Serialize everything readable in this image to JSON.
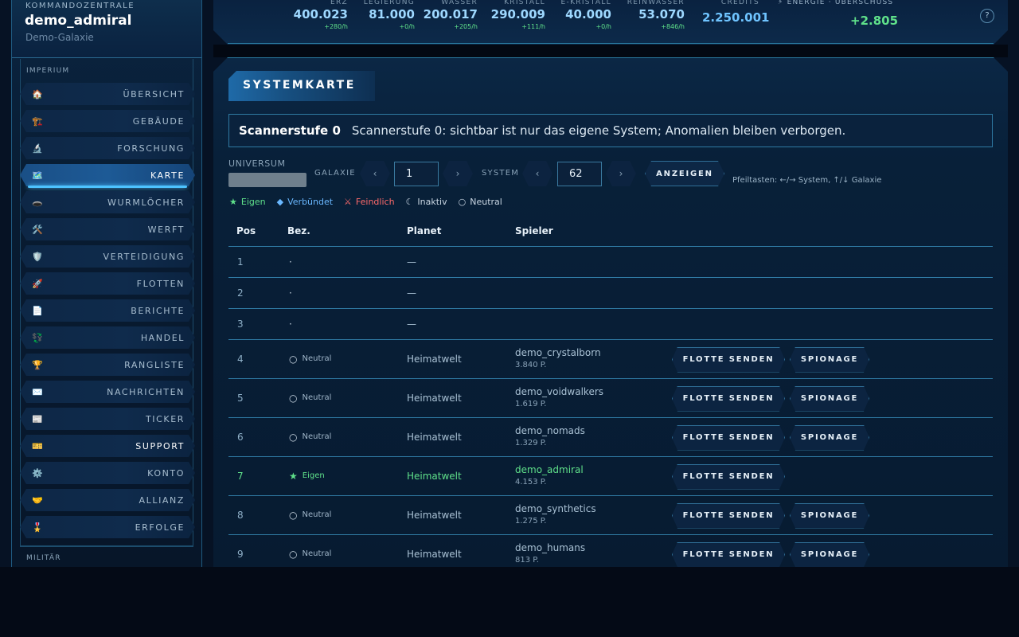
{
  "sidebar": {
    "kicker": "KOMMANDOZENTRALE",
    "username": "demo_admiral",
    "galaxy": "Demo-Galaxie",
    "section_empire": "IMPERIUM",
    "section_military": "MILITÄR",
    "items": [
      {
        "icon": "🏠",
        "label": "ÜBERSICHT"
      },
      {
        "icon": "🏗️",
        "label": "GEBÄUDE"
      },
      {
        "icon": "🔬",
        "label": "FORSCHUNG"
      },
      {
        "icon": "🗺️",
        "label": "KARTE"
      },
      {
        "icon": "🕳️",
        "label": "WURMLÖCHER"
      },
      {
        "icon": "🛠️",
        "label": "WERFT"
      },
      {
        "icon": "🛡️",
        "label": "VERTEIDIGUNG"
      },
      {
        "icon": "🚀",
        "label": "FLOTTEN"
      },
      {
        "icon": "📄",
        "label": "BERICHTE"
      },
      {
        "icon": "💱",
        "label": "HANDEL"
      },
      {
        "icon": "🏆",
        "label": "RANGLISTE"
      },
      {
        "icon": "✉️",
        "label": "NACHRICHTEN"
      },
      {
        "icon": "📰",
        "label": "TICKER"
      },
      {
        "icon": "🎫",
        "label": "SUPPORT"
      },
      {
        "icon": "⚙️",
        "label": "KONTO"
      },
      {
        "icon": "🤝",
        "label": "ALLIANZ"
      },
      {
        "icon": "🎖️",
        "label": "ERFOLGE"
      }
    ]
  },
  "resources": [
    {
      "label": "ERZ",
      "value": "400.023",
      "rate": "+280/h"
    },
    {
      "label": "LEGIERUNG",
      "value": "81.000",
      "rate": "+0/h"
    },
    {
      "label": "WASSER",
      "value": "200.017",
      "rate": "+205/h"
    },
    {
      "label": "KRISTALL",
      "value": "290.009",
      "rate": "+111/h"
    },
    {
      "label": "E-KRISTALL",
      "value": "40.000",
      "rate": "+0/h"
    },
    {
      "label": "REINWASSER",
      "value": "53.070",
      "rate": "+846/h"
    }
  ],
  "credits": {
    "label": "CREDITS",
    "value": "2.250.001"
  },
  "energy": {
    "label": "⚡ ENERGIE · ÜBERSCHUSS",
    "value": "+2.805"
  },
  "help_label": "?",
  "page": {
    "title": "SYSTEMKARTE",
    "scanner_level": "Scannerstufe 0",
    "scanner_text": "Scannerstufe 0: sichtbar ist nur das eigene System; Anomalien bleiben verborgen."
  },
  "controls": {
    "universe_label": "UNIVERSUM",
    "galaxy_label": "GALAXIE",
    "galaxy_value": "1",
    "system_label": "SYSTEM",
    "system_value": "62",
    "prev": "‹",
    "next": "›",
    "show_button": "ANZEIGEN",
    "hint": "Pfeiltasten: ←/→ System, ↑/↓ Galaxie"
  },
  "legend": [
    {
      "icon": "★",
      "label": "Eigen",
      "color": "#5fe08a"
    },
    {
      "icon": "◆",
      "label": "Verbündet",
      "color": "#6ab8ff"
    },
    {
      "icon": "⚔",
      "label": "Feindlich",
      "color": "#ff6a6a"
    },
    {
      "icon": "☾",
      "label": "Inaktiv",
      "color": "#c9d6e2"
    },
    {
      "icon": "○",
      "label": "Neutral",
      "color": "#c9d6e2"
    }
  ],
  "table": {
    "headers": [
      "Pos",
      "Bez.",
      "Planet",
      "Spieler"
    ],
    "rows": [
      {
        "pos": "1",
        "bez_icon": "·",
        "bez": "",
        "planet": "—",
        "player": "",
        "points": "",
        "actions": []
      },
      {
        "pos": "2",
        "bez_icon": "·",
        "bez": "",
        "planet": "—",
        "player": "",
        "points": "",
        "actions": []
      },
      {
        "pos": "3",
        "bez_icon": "·",
        "bez": "",
        "planet": "—",
        "player": "",
        "points": "",
        "actions": []
      },
      {
        "pos": "4",
        "bez_icon": "○",
        "bez": "Neutral",
        "planet": "Heimatwelt",
        "player": "demo_crystalborn",
        "points": "3.840 P.",
        "actions": [
          "FLOTTE SENDEN",
          "SPIONAGE"
        ]
      },
      {
        "pos": "5",
        "bez_icon": "○",
        "bez": "Neutral",
        "planet": "Heimatwelt",
        "player": "demo_voidwalkers",
        "points": "1.619 P.",
        "actions": [
          "FLOTTE SENDEN",
          "SPIONAGE"
        ]
      },
      {
        "pos": "6",
        "bez_icon": "○",
        "bez": "Neutral",
        "planet": "Heimatwelt",
        "player": "demo_nomads",
        "points": "1.329 P.",
        "actions": [
          "FLOTTE SENDEN",
          "SPIONAGE"
        ]
      },
      {
        "pos": "7",
        "bez_icon": "★",
        "bez": "Eigen",
        "planet": "Heimatwelt",
        "player": "demo_admiral",
        "points": "4.153 P.",
        "actions": [
          "FLOTTE SENDEN"
        ],
        "own": true
      },
      {
        "pos": "8",
        "bez_icon": "○",
        "bez": "Neutral",
        "planet": "Heimatwelt",
        "player": "demo_synthetics",
        "points": "1.275 P.",
        "actions": [
          "FLOTTE SENDEN",
          "SPIONAGE"
        ]
      },
      {
        "pos": "9",
        "bez_icon": "○",
        "bez": "Neutral",
        "planet": "Heimatwelt",
        "player": "demo_humans",
        "points": "813 P.",
        "actions": [
          "FLOTTE SENDEN",
          "SPIONAGE"
        ]
      }
    ]
  }
}
